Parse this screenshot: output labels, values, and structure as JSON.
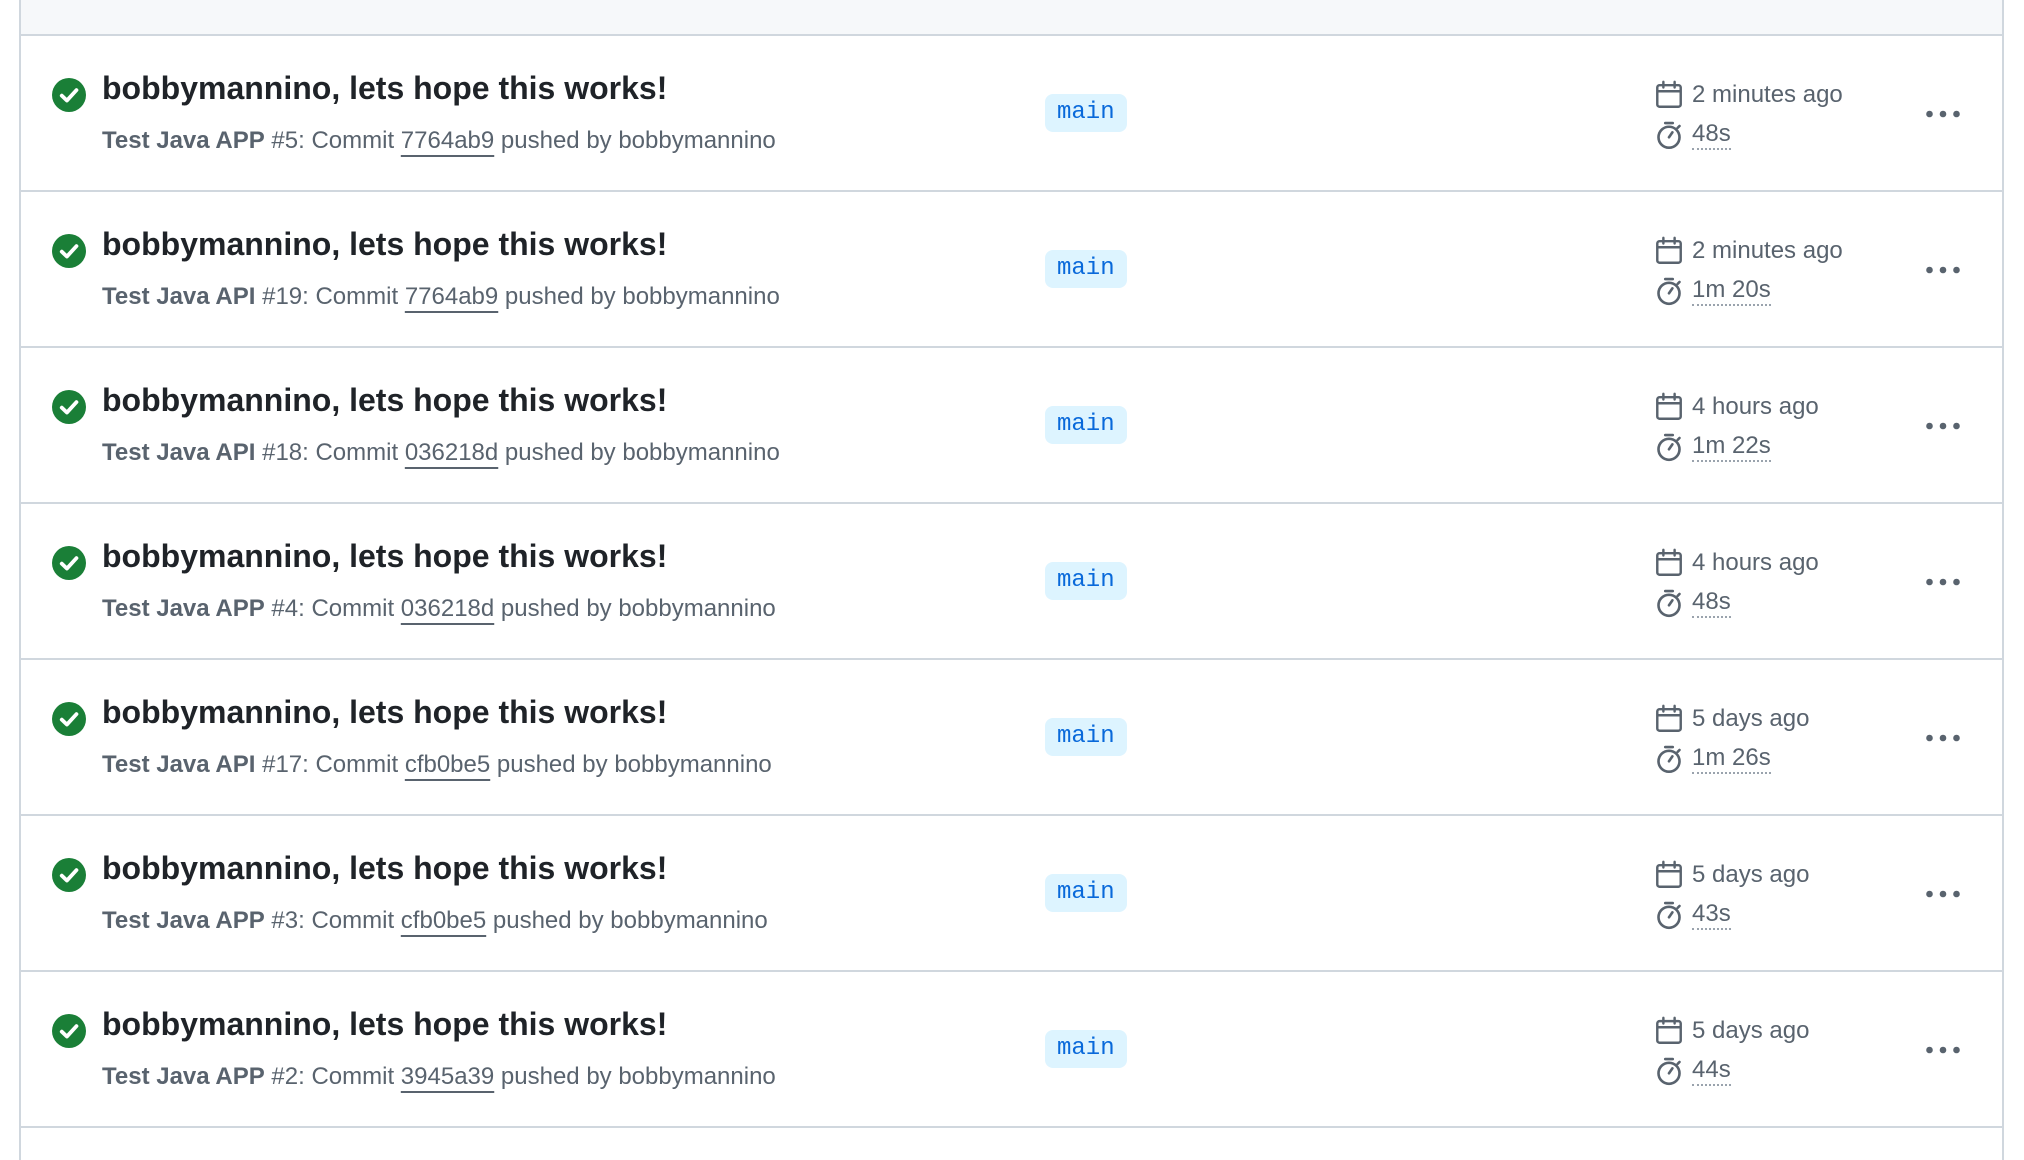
{
  "runs": [
    {
      "title": "bobbymannino, lets hope this works!",
      "workflow": "Test Java APP",
      "run_number": "#5",
      "commit_prefix": ": Commit",
      "commit": "7764ab9",
      "pushed_by": "pushed by bobbymannino",
      "branch": "main",
      "time_ago": "2 minutes ago",
      "duration": "48s"
    },
    {
      "title": "bobbymannino, lets hope this works!",
      "workflow": "Test Java API",
      "run_number": "#19",
      "commit_prefix": ": Commit",
      "commit": "7764ab9",
      "pushed_by": "pushed by bobbymannino",
      "branch": "main",
      "time_ago": "2 minutes ago",
      "duration": "1m 20s"
    },
    {
      "title": "bobbymannino, lets hope this works!",
      "workflow": "Test Java API",
      "run_number": "#18",
      "commit_prefix": ": Commit",
      "commit": "036218d",
      "pushed_by": "pushed by bobbymannino",
      "branch": "main",
      "time_ago": "4 hours ago",
      "duration": "1m 22s"
    },
    {
      "title": "bobbymannino, lets hope this works!",
      "workflow": "Test Java APP",
      "run_number": "#4",
      "commit_prefix": ": Commit",
      "commit": "036218d",
      "pushed_by": "pushed by bobbymannino",
      "branch": "main",
      "time_ago": "4 hours ago",
      "duration": "48s"
    },
    {
      "title": "bobbymannino, lets hope this works!",
      "workflow": "Test Java API",
      "run_number": "#17",
      "commit_prefix": ": Commit",
      "commit": "cfb0be5",
      "pushed_by": "pushed by bobbymannino",
      "branch": "main",
      "time_ago": "5 days ago",
      "duration": "1m 26s"
    },
    {
      "title": "bobbymannino, lets hope this works!",
      "workflow": "Test Java APP",
      "run_number": "#3",
      "commit_prefix": ": Commit",
      "commit": "cfb0be5",
      "pushed_by": "pushed by bobbymannino",
      "branch": "main",
      "time_ago": "5 days ago",
      "duration": "43s"
    },
    {
      "title": "bobbymannino, lets hope this works!",
      "workflow": "Test Java APP",
      "run_number": "#2",
      "commit_prefix": ": Commit",
      "commit": "3945a39",
      "pushed_by": "pushed by bobbymannino",
      "branch": "main",
      "time_ago": "5 days ago",
      "duration": "44s"
    }
  ],
  "icons": {
    "status": "check-circle-fill-icon",
    "time_ago": "calendar-icon",
    "duration": "stopwatch-icon",
    "more": "kebab-horizontal-icon"
  },
  "colors": {
    "success": "#1a7f37",
    "branch_bg": "#ddf4ff",
    "branch_fg": "#0969da",
    "muted_text": "#59636e",
    "border": "#d0d7de"
  }
}
